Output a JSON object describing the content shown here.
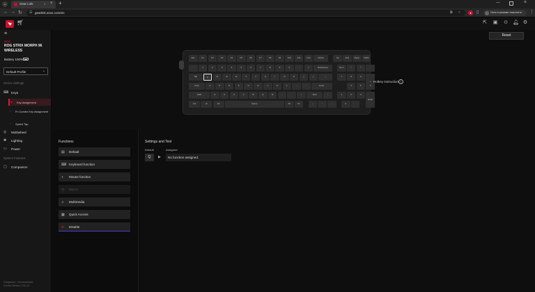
{
  "browser": {
    "tab_title": "Gear Link",
    "url": "gearlink.asus.com/en",
    "profile_text": "Окно в режиме инкогнито"
  },
  "sidebar": {
    "brand": "ROG",
    "device_name": "ROG STRIX MORPH 96 WIRELESS",
    "battery": "Battery 100%",
    "profile_select": "Default Profile",
    "section_device": "Device Settings",
    "keys": "Keys",
    "key_assignment": "Key Assignment",
    "combo_assignment": "Fn Combo Key Assignment",
    "speed_tap": "Speed Tap",
    "multiwheel": "Multiwheel",
    "lighting": "Lighting",
    "power": "Power",
    "section_system": "System Features",
    "companion": "Companion",
    "footer_line1": "Companion - Not connected",
    "footer_line2": "Current Version: 1.00.13"
  },
  "header": {
    "reset": "Reset"
  },
  "keyboard": {
    "hotkey_label": "Hotkey Instruction",
    "rows": [
      [
        "Esc",
        "F1",
        "F2",
        "F3",
        "F4",
        "F5",
        "F6",
        "F7",
        "F8",
        "F9",
        "F10",
        "F11",
        "F12",
        "Delete",
        "Ins",
        "End",
        "PgUp",
        "PgDn"
      ],
      [
        "`",
        "1",
        "2",
        "3",
        "4",
        "5",
        "6",
        "7",
        "8",
        "9",
        "0",
        "-",
        "=",
        "Backspace",
        "Num",
        "/",
        "*",
        "-"
      ],
      [
        "Tab",
        "Q",
        "W",
        "E",
        "R",
        "T",
        "Y",
        "U",
        "I",
        "O",
        "P",
        "[",
        "]",
        "\\",
        "7",
        "8",
        "9",
        "+"
      ],
      [
        "Caps",
        "A",
        "S",
        "D",
        "F",
        "G",
        "H",
        "J",
        "K",
        "L",
        ";",
        "'",
        "Enter",
        "4",
        "5",
        "6"
      ],
      [
        "Shift",
        "Z",
        "X",
        "C",
        "V",
        "B",
        "N",
        "M",
        ",",
        ".",
        "/",
        "Shift",
        "↑",
        "1",
        "2",
        "3",
        "Enter"
      ],
      [
        "Ctrl",
        "⊞",
        "Alt",
        "Space",
        "Alt",
        "Fn",
        "←",
        "↓",
        "→",
        "0",
        "."
      ]
    ]
  },
  "functions": {
    "title": "Functions",
    "items": [
      {
        "label": "Default",
        "icon": "default-icon"
      },
      {
        "label": "Keyboard function",
        "icon": "keyboard-icon"
      },
      {
        "label": "Mouse function",
        "icon": "mouse-icon"
      },
      {
        "label": "Macro",
        "icon": "macro-icon"
      },
      {
        "label": "Multimedia",
        "icon": "multimedia-icon"
      },
      {
        "label": "Quick Access",
        "icon": "quick-access-icon"
      },
      {
        "label": "Disable",
        "icon": "disable-icon"
      }
    ]
  },
  "settings": {
    "title": "Settings and Test",
    "default_label": "Default",
    "assigned_label": "Assigned",
    "default_key": "Q",
    "assigned_value": "No function assigned."
  }
}
